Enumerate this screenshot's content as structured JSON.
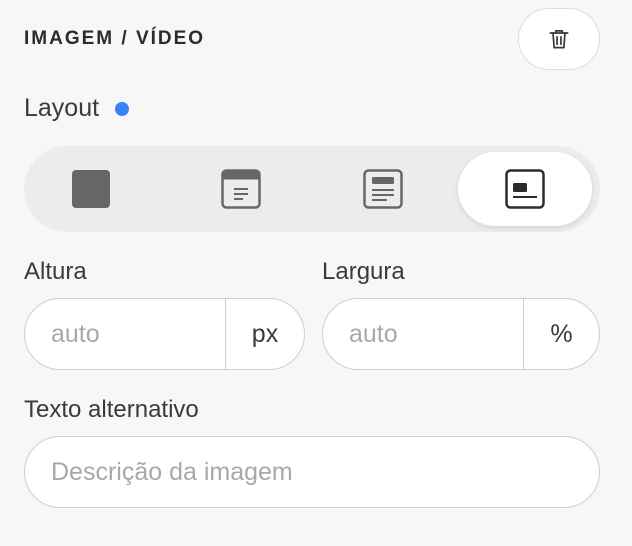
{
  "section": {
    "title": "IMAGEM / VÍDEO",
    "delete_icon": "trash-icon"
  },
  "layout": {
    "label": "Layout",
    "indicator_color": "#3b82f6",
    "options": [
      {
        "name": "full-image",
        "icon": "solid-square-icon",
        "selected": false
      },
      {
        "name": "image-top",
        "icon": "image-top-layout-icon",
        "selected": false
      },
      {
        "name": "image-header",
        "icon": "image-header-layout-icon",
        "selected": false
      },
      {
        "name": "image-left",
        "icon": "image-left-layout-icon",
        "selected": true
      }
    ]
  },
  "height": {
    "label": "Altura",
    "placeholder": "auto",
    "value": "",
    "unit": "px"
  },
  "width": {
    "label": "Largura",
    "placeholder": "auto",
    "value": "",
    "unit": "%"
  },
  "alt_text": {
    "label": "Texto alternativo",
    "placeholder": "Descrição da imagem",
    "value": ""
  },
  "colors": {
    "accent": "#3b82f6",
    "border": "#cfcfd2",
    "background": "#f7f7f8"
  }
}
